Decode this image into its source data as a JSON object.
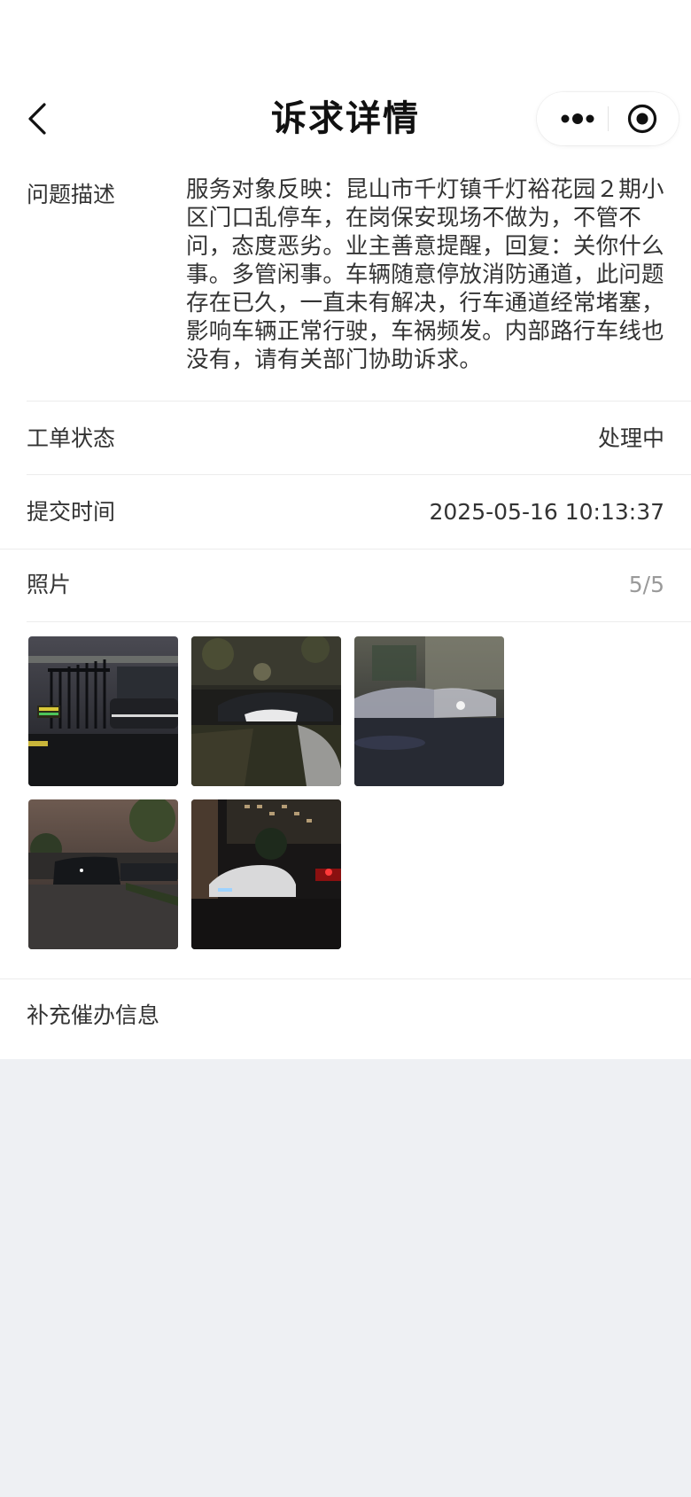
{
  "nav": {
    "title": "诉求详情"
  },
  "description": {
    "label": "问题描述",
    "text": "服务对象反映：昆山市千灯镇千灯裕花园２期小区门口乱停车，在岗保安现场不做为，不管不问，态度恶劣。业主善意提醒，回复：关你什么事。多管闲事。车辆随意停放消防通道，此问题存在已久，一直未有解决，行车通道经常堵塞，影响车辆正常行驶，车祸频发。内部路行车线也没有，请有关部门协助诉求。"
  },
  "status": {
    "label": "工单状态",
    "value": "处理中"
  },
  "submit_time": {
    "label": "提交时间",
    "value": "2025-05-16 10:13:37"
  },
  "photos": {
    "label": "照片",
    "count": "5/5",
    "items": [
      {
        "icon": "photo-gate-night"
      },
      {
        "icon": "photo-cars-parked-night"
      },
      {
        "icon": "photo-blurred-cars"
      },
      {
        "icon": "photo-street-cars-night"
      },
      {
        "icon": "photo-white-car-night"
      }
    ]
  },
  "supplement": {
    "label": "补充催办信息"
  },
  "colors": {
    "background": "#eef0f3",
    "card": "#ffffff",
    "text": "#333333",
    "muted": "#9a9a9a"
  }
}
